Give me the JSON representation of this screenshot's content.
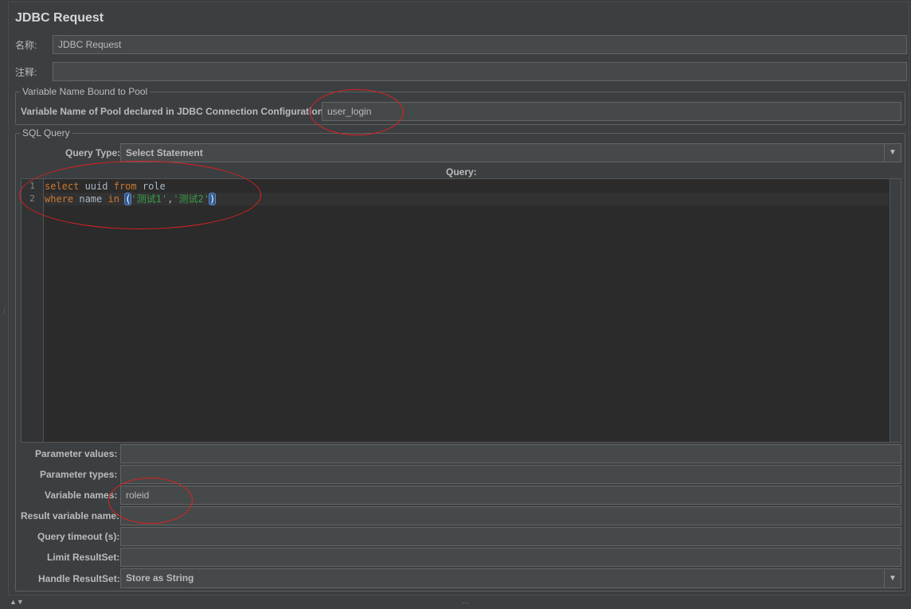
{
  "panel": {
    "title": "JDBC Request",
    "name_label": "名称:",
    "name_value": "JDBC Request",
    "comment_label": "注释:",
    "comment_value": ""
  },
  "pool_section": {
    "title": "Variable Name Bound to Pool",
    "pool_label": "Variable Name of Pool declared in JDBC Connection Configuration:",
    "pool_value": "user_login"
  },
  "sql_section": {
    "title": "SQL Query",
    "query_type_label": "Query Type:",
    "query_type_value": "Select Statement",
    "query_label": "Query:",
    "line_numbers": [
      "1",
      "2"
    ],
    "code": {
      "l1_kw1": "select",
      "l1_t1": " uuid ",
      "l1_kw2": "from",
      "l1_t2": " role",
      "l2_kw1": "where",
      "l2_t1": " name ",
      "l2_kw2": "in",
      "l2_sp": " ",
      "l2_open": "(",
      "l2_s1": "'测试1'",
      "l2_comma": ",",
      "l2_s2": "'测试2'",
      "l2_close": ")"
    }
  },
  "params": {
    "parameter_values_label": "Parameter values:",
    "parameter_values": "",
    "parameter_types_label": "Parameter types:",
    "parameter_types": "",
    "variable_names_label": "Variable names:",
    "variable_names": "roleid",
    "result_variable_label": "Result variable name:",
    "result_variable": "",
    "query_timeout_label": "Query timeout (s):",
    "query_timeout": "",
    "limit_resultset_label": "Limit ResultSet:",
    "limit_resultset": "",
    "handle_resultset_label": "Handle ResultSet:",
    "handle_resultset_value": "Store as String"
  },
  "annotations": {
    "ring_color": "#e02020"
  },
  "colors": {
    "keyword": "#cc7832",
    "string": "#39a04a",
    "background": "#3c3f41"
  }
}
